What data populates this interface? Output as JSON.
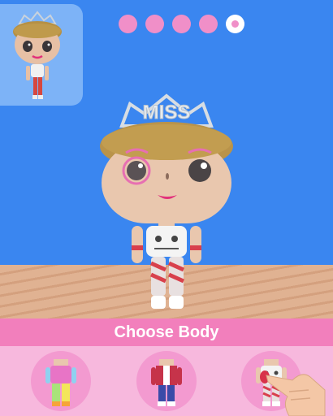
{
  "hud": {
    "progress": {
      "total_steps": 5,
      "current_step": 5
    },
    "colors": {
      "dot": "#f08fc8",
      "dot_current_ring": "#ffffff",
      "background": "#3a86f0"
    }
  },
  "doll": {
    "tiara_text": "MISS"
  },
  "selector": {
    "title": "Choose Body",
    "options": [
      {
        "name": "rainbow-body",
        "selected": false
      },
      {
        "name": "jacket-body",
        "selected": false
      },
      {
        "name": "striped-body",
        "selected": true
      }
    ]
  }
}
